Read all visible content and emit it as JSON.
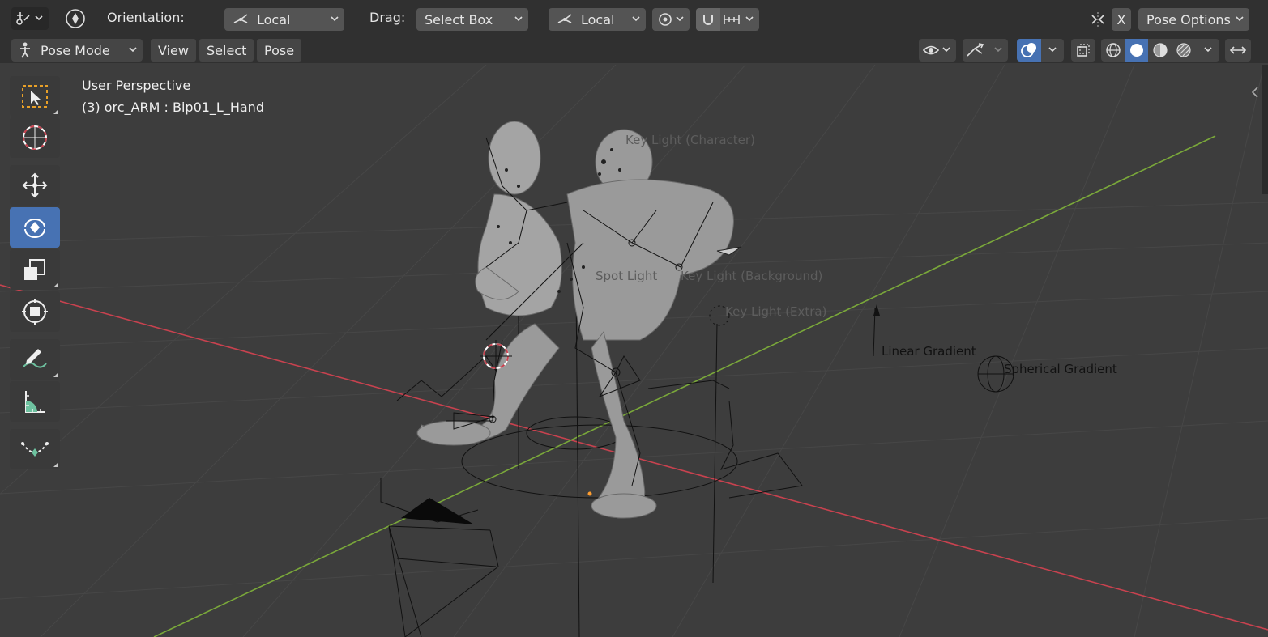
{
  "header": {
    "orientation_label": "Orientation:",
    "orientation_value": "Local",
    "drag_label": "Drag:",
    "drag_value": "Select Box",
    "pivot_value": "Local",
    "x_label": "X",
    "pose_options": "Pose Options"
  },
  "mode_bar": {
    "mode": "Pose Mode",
    "menus": [
      "View",
      "Select",
      "Pose"
    ]
  },
  "viewport": {
    "view_name": "User Perspective",
    "active_object": "(3) orc_ARM : Bip01_L_Hand",
    "labels": {
      "key_character": "Key Light (Character)",
      "key_background": "Key Light (Background)",
      "spot_light": "Spot Light",
      "key_extra": "Key Light (Extra)",
      "linear_gradient": "Linear Gradient",
      "spherical_gradient": "Spherical Gradient"
    }
  },
  "tools": [
    "select-box",
    "cursor",
    "move",
    "rotate",
    "scale",
    "transform",
    "annotate",
    "measure",
    "bone-curve"
  ],
  "active_tool": "rotate",
  "colors": {
    "active": "#4772b3",
    "x_axis": "#c8424f",
    "y_axis": "#7aa83a"
  }
}
